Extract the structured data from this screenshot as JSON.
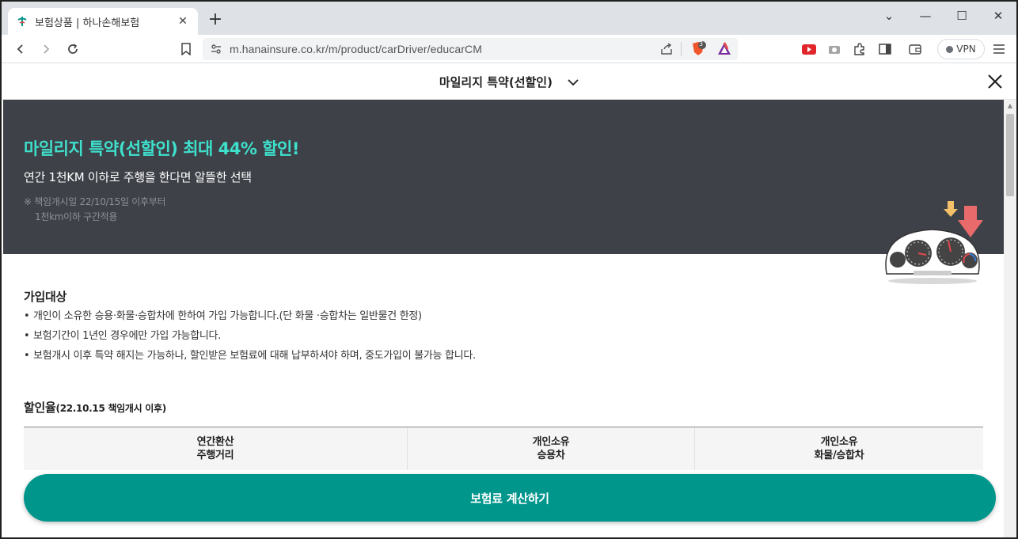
{
  "browser": {
    "tab": {
      "title": "보험상품 | 하나손해보험",
      "close": "✕"
    },
    "new_tab": "+",
    "window": {
      "minimize": "—",
      "maximize": "☐",
      "close": "✕",
      "dropdown": "⌄"
    },
    "url": "m.hanainsure.co.kr/m/product/carDriver/educarCM",
    "brave_badge": "3",
    "vpn_label": "VPN"
  },
  "page": {
    "header_title": "마일리지 특약(선할인)",
    "banner": {
      "headline": "마일리지 특약(선할인) 최대 44% 할인!",
      "subline": "연간 1천KM 이하로 주행을 한다면 알뜰한 선택",
      "note_line1": "※ 책임개시일 22/10/15일 이후부터",
      "note_line2": "1천km이하 구간적용",
      "accent_color": "#3ee0cc",
      "background_color": "#3e4148"
    },
    "eligibility": {
      "title": "가입대상",
      "items": [
        "개인이 소유한 승용·화물·승합차에 한하여 가입 가능합니다.(단 화물 ·승합차는 일반물건 한정)",
        "보험기간이 1년인 경우에만 가입 가능합니다.",
        "보험개시 이후 특약 해지는 가능하나, 할인받은 보험료에 대해 납부하셔야 하며, 중도가입이 불가능 합니다."
      ]
    },
    "discount": {
      "title_main": "할인율",
      "title_sub": "(22.10.15 책임개시 이후)",
      "columns": [
        {
          "line1": "연간환산",
          "line2": "주행거리"
        },
        {
          "line1": "개인소유",
          "line2": "승용차"
        },
        {
          "line1": "개인소유",
          "line2": "화물/승합차"
        }
      ]
    },
    "cta_label": "보험료 계산하기",
    "brand_color": "#00968c"
  }
}
